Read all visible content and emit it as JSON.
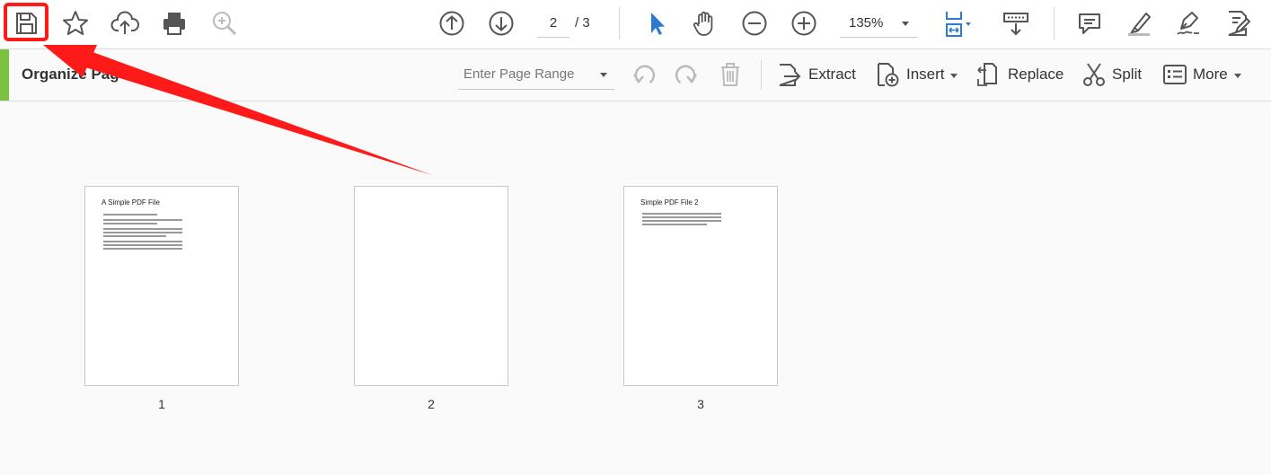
{
  "toolbar": {
    "page_current": "2",
    "page_total": "/ 3",
    "zoom_value": "135%",
    "icons": [
      "save-icon",
      "star-icon",
      "cloud-upload-icon",
      "print-icon",
      "zoom-search-icon",
      "page-up-icon",
      "page-down-icon",
      "select-arrow-icon",
      "hand-icon",
      "zoom-out-icon",
      "zoom-in-icon",
      "fit-page-icon",
      "scroll-mode-icon",
      "comment-icon",
      "highlight-icon",
      "sign-icon",
      "edit-icon"
    ]
  },
  "organize": {
    "title": "Organize Pag",
    "range_placeholder": "Enter Page Range",
    "extract_label": "Extract",
    "insert_label": "Insert",
    "replace_label": "Replace",
    "split_label": "Split",
    "more_label": "More"
  },
  "pages": [
    {
      "number": "1",
      "title": "A Simple PDF File"
    },
    {
      "number": "2",
      "title": ""
    },
    {
      "number": "3",
      "title": "Simple PDF File 2"
    }
  ],
  "colors": {
    "accent_green": "#7cc242",
    "annotation_red": "#ff1a1a",
    "tool_blue": "#2b7bd2"
  }
}
